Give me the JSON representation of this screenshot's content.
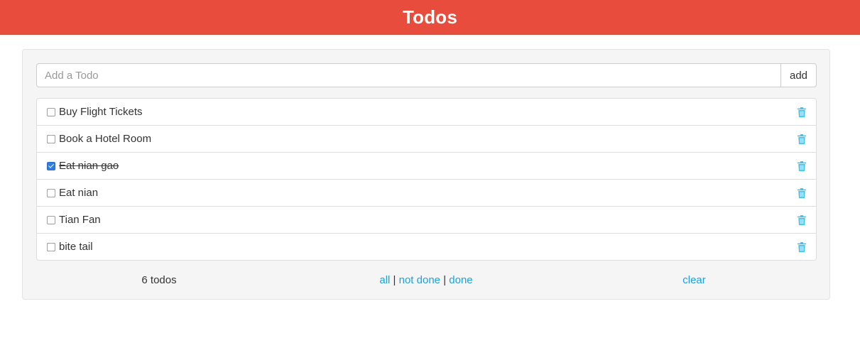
{
  "header": {
    "title": "Todos"
  },
  "add_form": {
    "placeholder": "Add a Todo",
    "value": "",
    "button_label": "add"
  },
  "todos": [
    {
      "text": "Buy Flight Tickets",
      "done": false
    },
    {
      "text": "Book a Hotel Room",
      "done": false
    },
    {
      "text": "Eat nian gao",
      "done": true
    },
    {
      "text": "Eat nian",
      "done": false
    },
    {
      "text": "Tian Fan",
      "done": false
    },
    {
      "text": "bite tail",
      "done": false
    }
  ],
  "footer": {
    "count_label": "6 todos",
    "filters": {
      "all": "all",
      "not_done": "not done",
      "done": "done",
      "separator": "|"
    },
    "clear_label": "clear"
  },
  "colors": {
    "header": "#e84c3d",
    "link": "#1ba1e2",
    "trash_icon": "#3ec4f0",
    "checkbox_checked": "#2f7de1"
  },
  "icons": {
    "delete": "trash-icon"
  }
}
